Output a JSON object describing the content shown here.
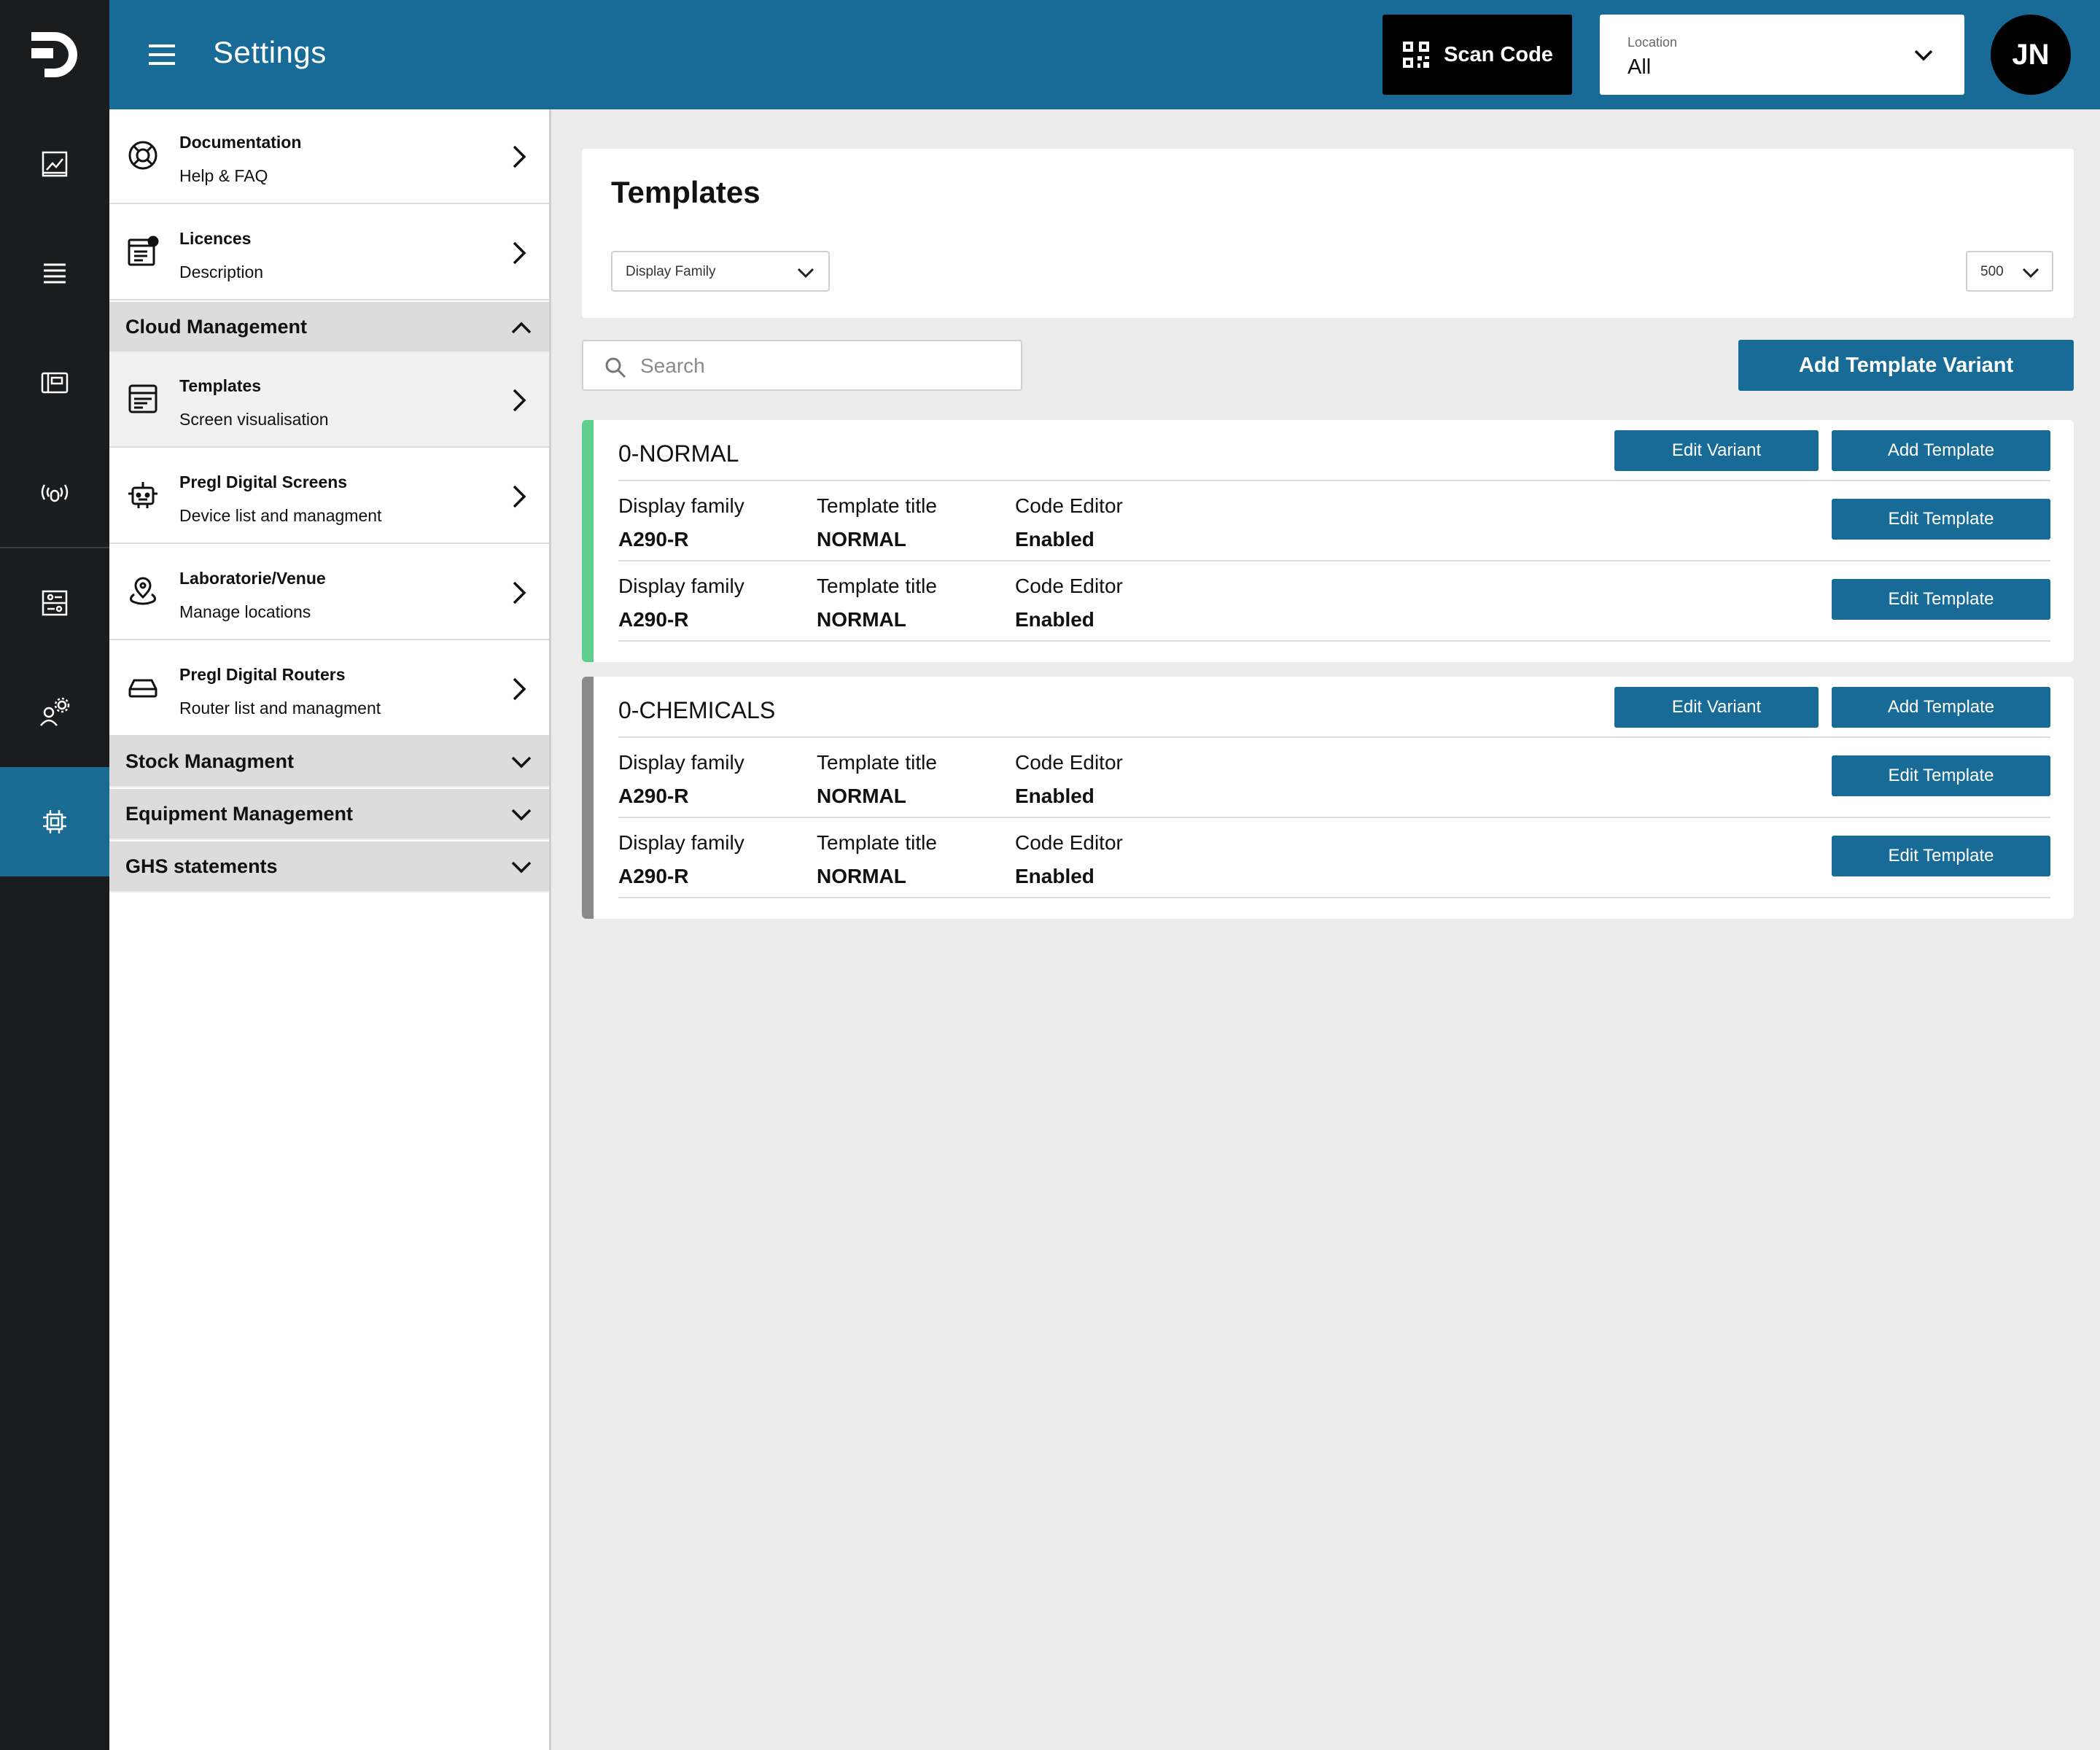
{
  "rail": {
    "items": [
      {
        "icon": "analytics-icon"
      },
      {
        "icon": "list-icon"
      },
      {
        "icon": "device-card-icon"
      },
      {
        "icon": "broadcast-icon"
      },
      {
        "icon": "tune-icon"
      },
      {
        "icon": "user-gear-icon"
      },
      {
        "icon": "chip-icon",
        "active": true
      }
    ]
  },
  "header": {
    "title": "Settings",
    "scan_label": "Scan Code",
    "location_label": "Location",
    "location_value": "All",
    "avatar_initials": "JN",
    "color": "#176b96"
  },
  "panel": {
    "items_top": [
      {
        "title": "Documentation",
        "subtitle": "Help & FAQ",
        "icon": "lifebuoy-icon"
      },
      {
        "title": "Licences",
        "subtitle": "Description",
        "icon": "licence-icon"
      }
    ],
    "sections": {
      "cloud": "Cloud Management",
      "stock": "Stock Managment",
      "equipment": "Equipment Management",
      "ghs": "GHS statements"
    },
    "cloud_items": [
      {
        "title": "Templates",
        "subtitle": "Screen visualisation",
        "icon": "template-icon",
        "active": true
      },
      {
        "title": "Pregl Digital Screens",
        "subtitle": "Device list and managment",
        "icon": "robot-icon"
      },
      {
        "title": "Laboratorie/Venue",
        "subtitle": "Manage locations",
        "icon": "location-pin-icon"
      },
      {
        "title": "Pregl Digital Routers",
        "subtitle": "Router list and managment",
        "icon": "router-icon"
      }
    ]
  },
  "main": {
    "title": "Templates",
    "family_filter": "Display Family",
    "page_size": "500",
    "search_placeholder": "Search",
    "add_variant_label": "Add Template Variant",
    "variants": [
      {
        "name": "0-NORMAL",
        "accent": "#5fcf8c",
        "edit_variant_label": "Edit Variant",
        "add_template_label": "Add Template",
        "templates": [
          {
            "k1": "Display family",
            "v1": "A290-R",
            "k2": "Template title",
            "v2": "NORMAL",
            "k3": "Code Editor",
            "v3": "Enabled",
            "button": "Edit Template"
          },
          {
            "k1": "Display family",
            "v1": "A290-R",
            "k2": "Template title",
            "v2": "NORMAL",
            "k3": "Code Editor",
            "v3": "Enabled",
            "button": "Edit Template"
          }
        ]
      },
      {
        "name": "0-CHEMICALS",
        "accent": "#8a8a8a",
        "edit_variant_label": "Edit Variant",
        "add_template_label": "Add Template",
        "templates": [
          {
            "k1": "Display family",
            "v1": "A290-R",
            "k2": "Template title",
            "v2": "NORMAL",
            "k3": "Code Editor",
            "v3": "Enabled",
            "button": "Edit Template"
          },
          {
            "k1": "Display family",
            "v1": "A290-R",
            "k2": "Template title",
            "v2": "NORMAL",
            "k3": "Code Editor",
            "v3": "Enabled",
            "button": "Edit Template"
          }
        ]
      }
    ]
  }
}
